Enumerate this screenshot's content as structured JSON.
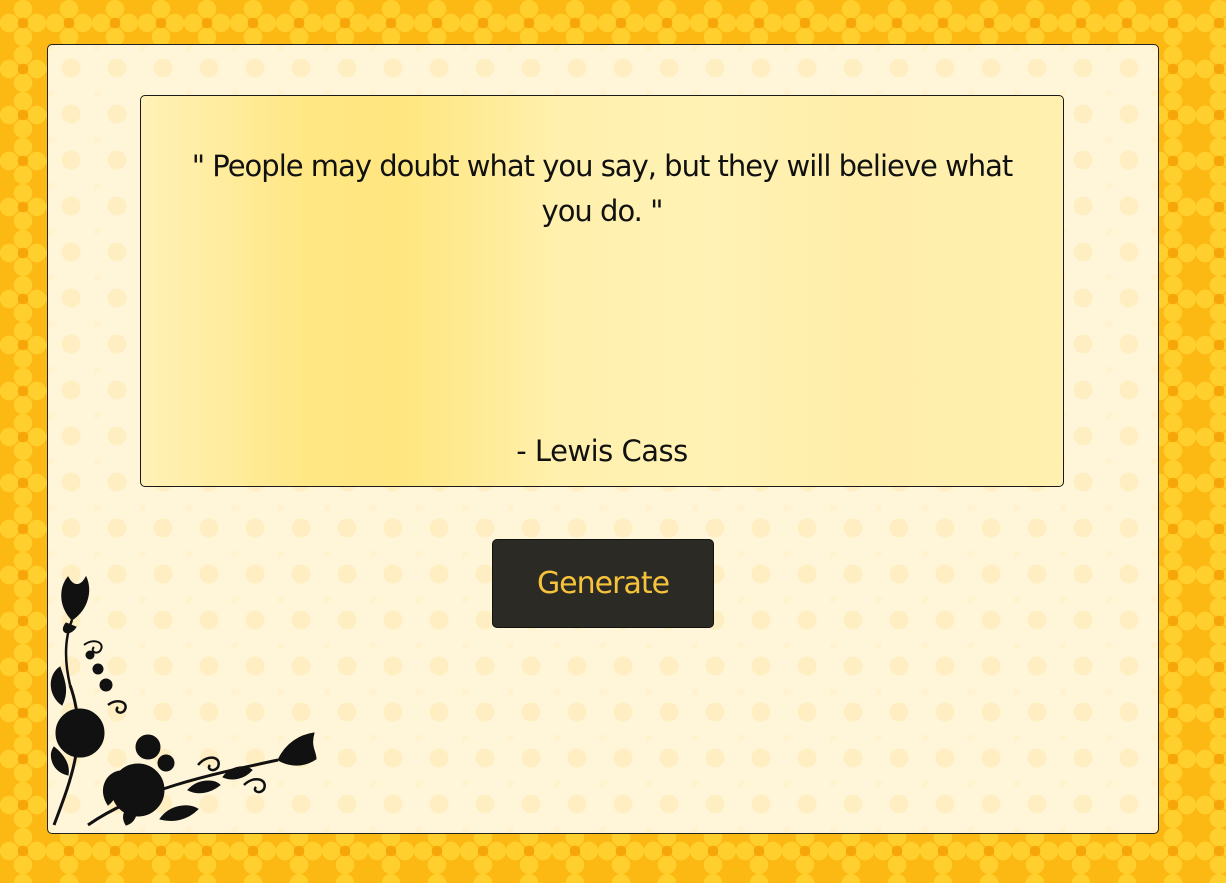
{
  "quote": {
    "text": "\" People may doubt what you say, but they will believe what you do. \"",
    "author": "- Lewis Cass"
  },
  "controls": {
    "generate_label": "Generate"
  },
  "decor": {
    "corner_ornament_icon": "floral-corner-icon",
    "colors": {
      "page_background": "#fdb913",
      "panel_background": "#fff5d8",
      "card_background": "#ffe784",
      "button_background": "#2b2a25",
      "button_text": "#f6c33a",
      "text": "#111111"
    }
  }
}
